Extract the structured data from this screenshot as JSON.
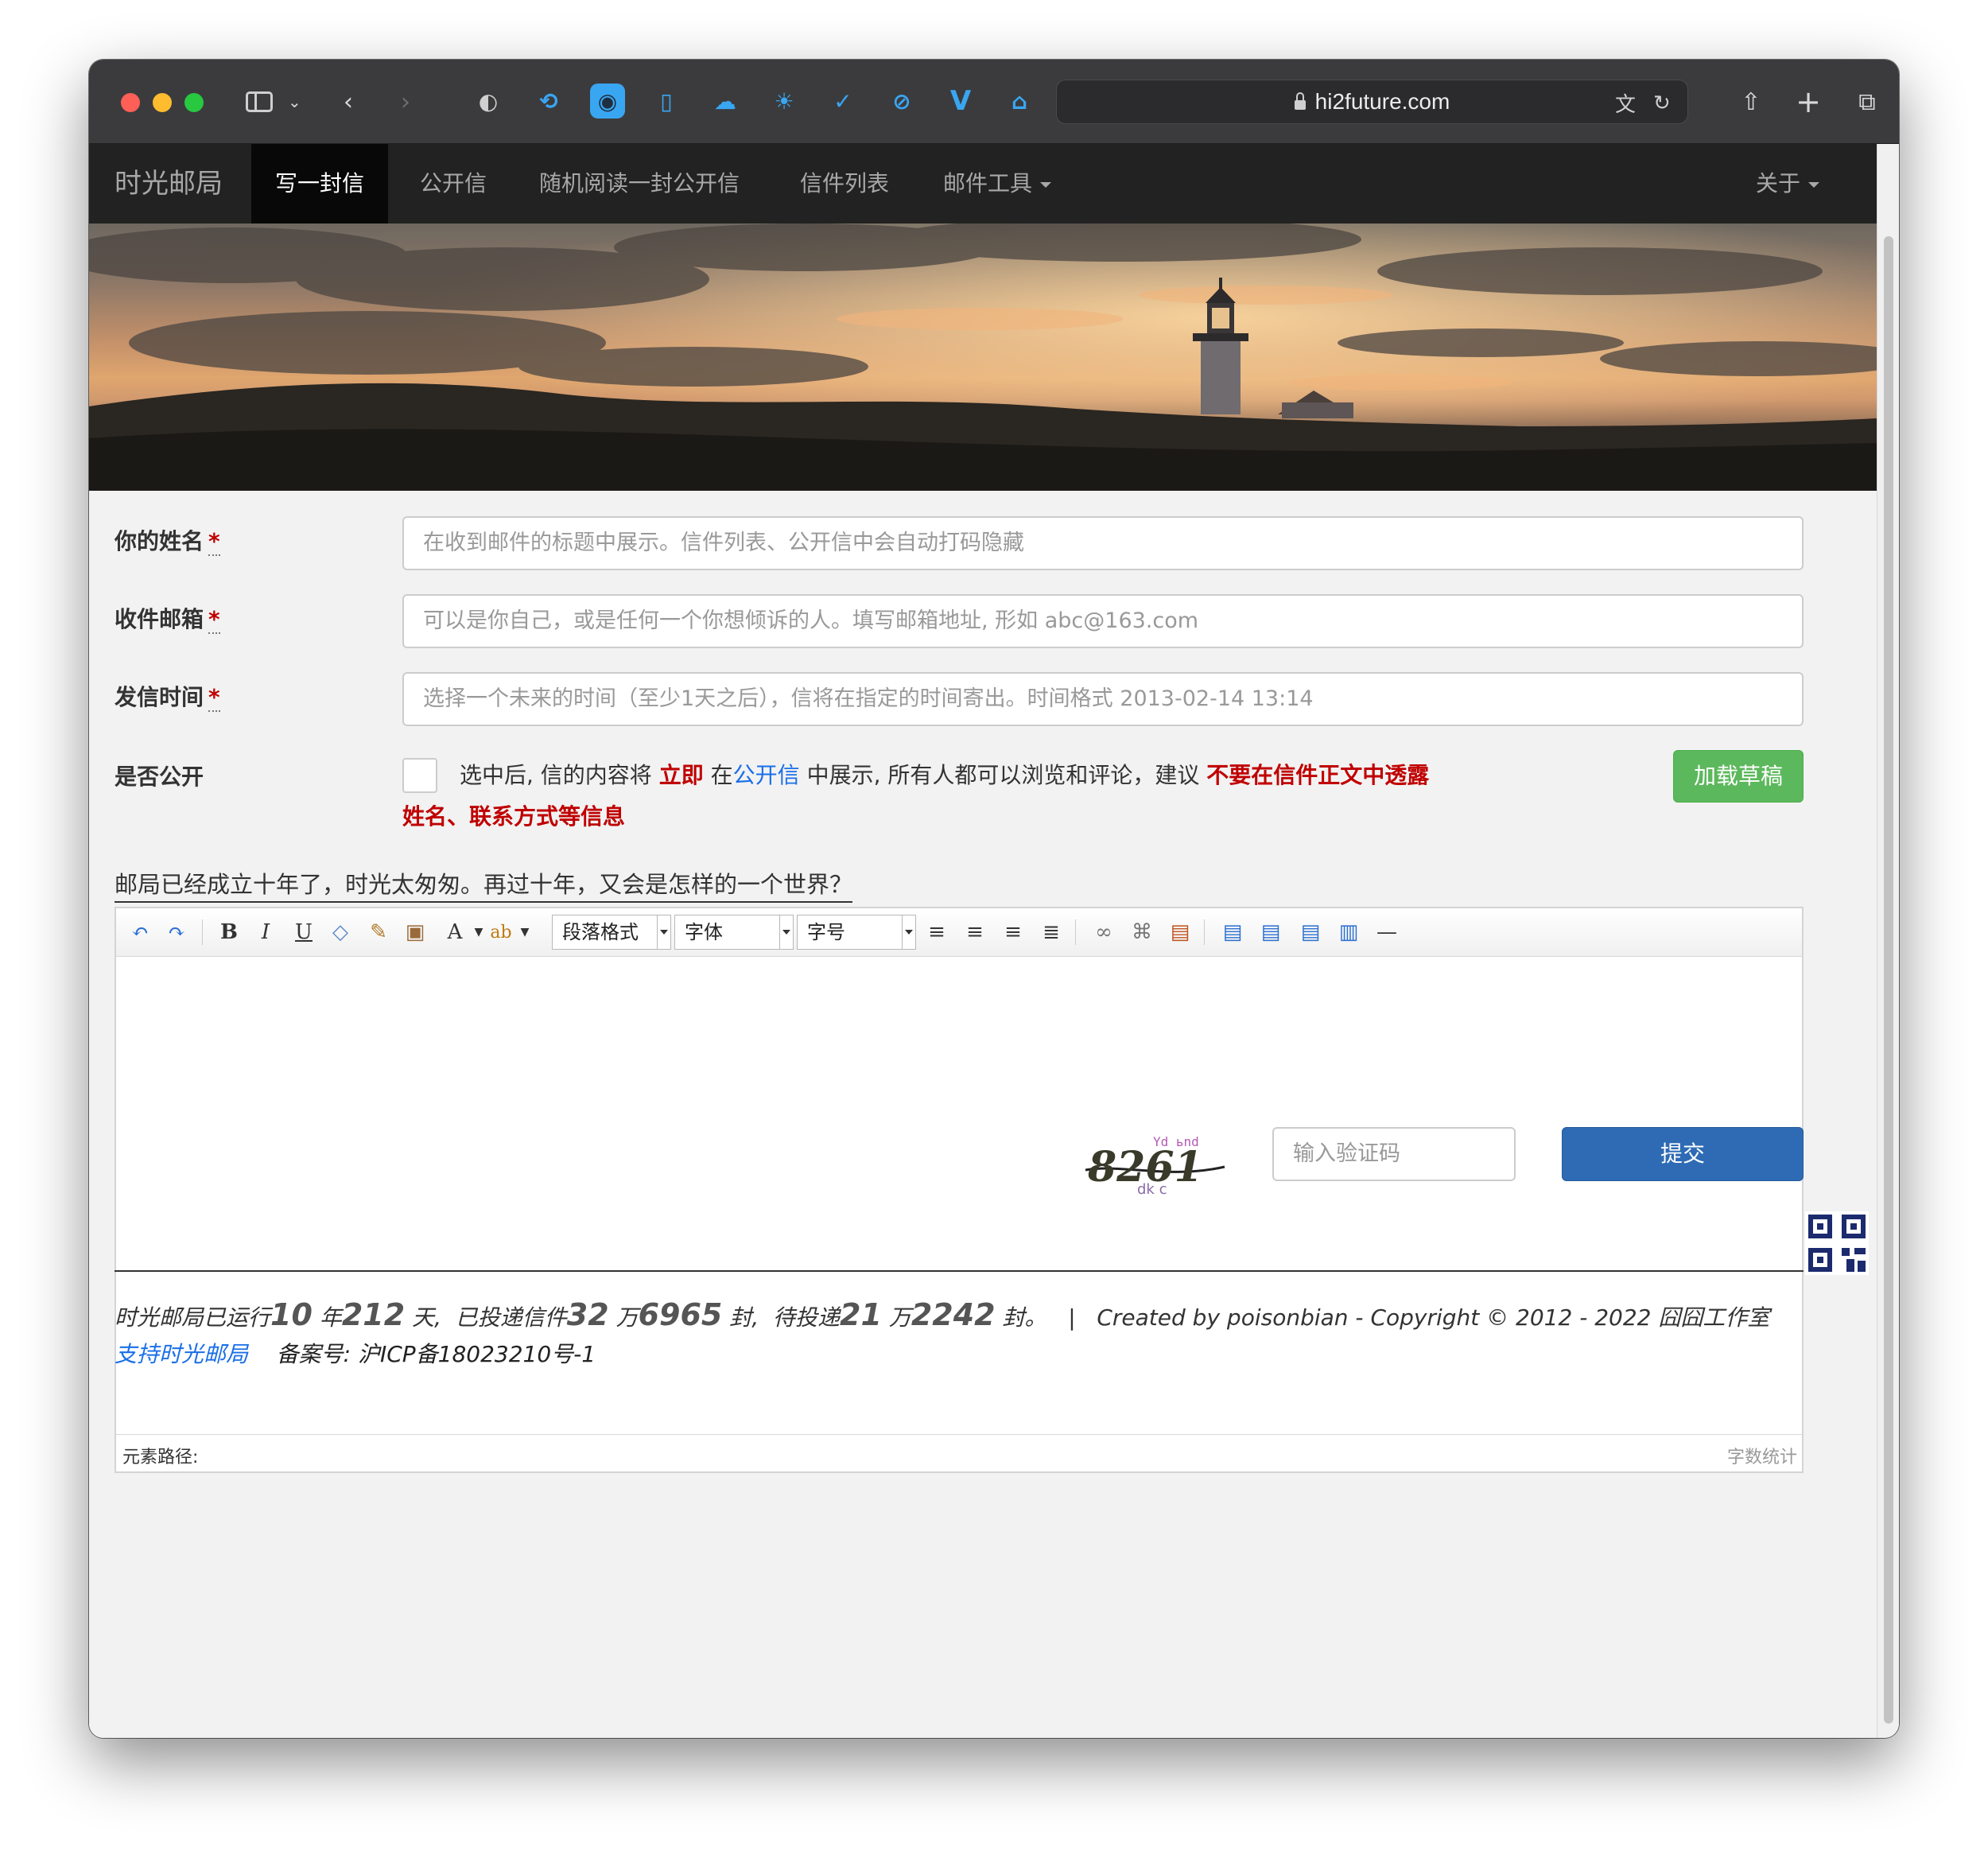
{
  "browser": {
    "url": "hi2future.com"
  },
  "nav": {
    "brand": "时光邮局",
    "items": [
      "写一封信",
      "公开信",
      "随机阅读一封公开信",
      "信件列表",
      "邮件工具"
    ],
    "about": "关于"
  },
  "form": {
    "name_label": "你的姓名",
    "name_placeholder": "在收到邮件的标题中展示。信件列表、公开信中会自动打码隐藏",
    "email_label": "收件邮箱",
    "email_placeholder": "可以是你自己，或是任何一个你想倾诉的人。填写邮箱地址, 形如 abc@163.com",
    "time_label": "发信时间",
    "time_placeholder": "选择一个未来的时间（至少1天之后），信将在指定的时间寄出。时间格式 2013-02-14 13:14",
    "required_mark": "*",
    "public_label": "是否公开",
    "public_text_1": "选中后, 信的内容将",
    "public_text_immediate": "立即",
    "public_text_2": "在",
    "public_text_link": "公开信",
    "public_text_3": "中展示, 所有人都可以浏览和评论，建议",
    "public_text_warning_1": "不要在信件正文中透露",
    "public_text_warning_2": "姓名、联系方式等信息",
    "load_draft": "加载草稿",
    "slogan": "邮局已经成立十年了，时光太匆匆。再过十年，又会是怎样的一个世界？"
  },
  "editor": {
    "format_select": "段落格式",
    "font_select": "字体",
    "size_select": "字号",
    "element_path": "元素路径:",
    "word_count": "字数统计"
  },
  "captcha": {
    "code": "8261",
    "placeholder": "输入验证码",
    "submit": "提交"
  },
  "footer": {
    "run_prefix": "时光邮局已运行",
    "run_years": "10",
    "run_year_unit": "年",
    "run_days": "212",
    "run_day_unit": "天,",
    "delivered_prefix": "已投递信件",
    "delivered_wan": "32",
    "wan": "万",
    "delivered_rest": "6965",
    "feng": "封,",
    "pending_prefix": "待投递",
    "pending_wan": "21",
    "pending_rest": "2242",
    "feng_end": "封。",
    "separator": "|",
    "credit": "Created by poisonbian - Copyright © 2012 - 2022 囧囧工作室",
    "support_link": "支持时光邮局",
    "icp": "备案号: 沪ICP备18023210号-1"
  }
}
